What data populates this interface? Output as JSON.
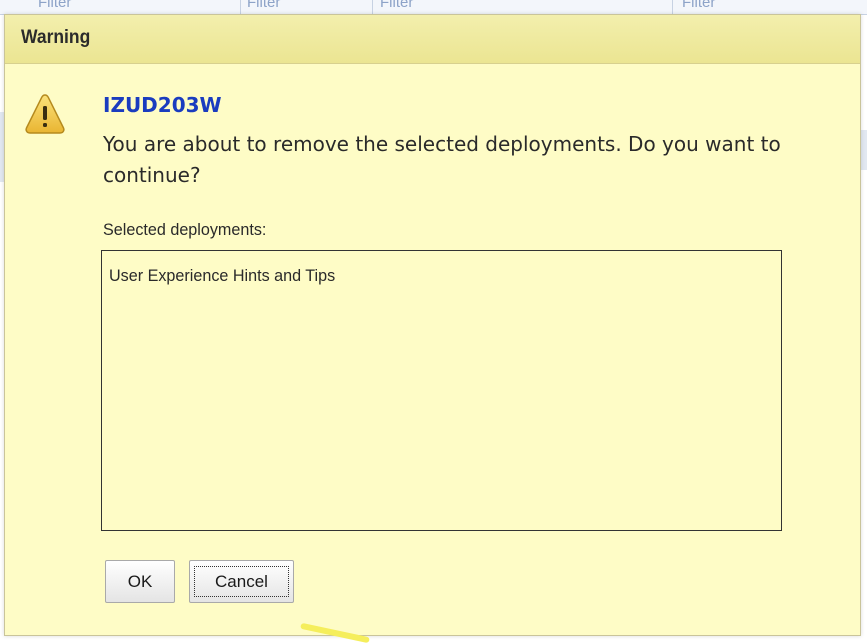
{
  "background": {
    "filters": [
      "Filter",
      "Filter",
      "Filter",
      "Filter"
    ]
  },
  "dialog": {
    "title": "Warning",
    "icon": "warning-icon",
    "message_id": "IZUD203W",
    "message": "You are about to remove the selected deployments. Do you want to continue?",
    "list_label": "Selected deployments:",
    "deployments": [
      "User Experience Hints and Tips"
    ],
    "buttons": {
      "ok_label": "OK",
      "cancel_label": "Cancel"
    }
  },
  "colors": {
    "dialog_background": "#fefcc6",
    "header_background": "#ebe592",
    "message_id": "#1a3cbf",
    "warning_icon_fill": "#f2c94c"
  }
}
